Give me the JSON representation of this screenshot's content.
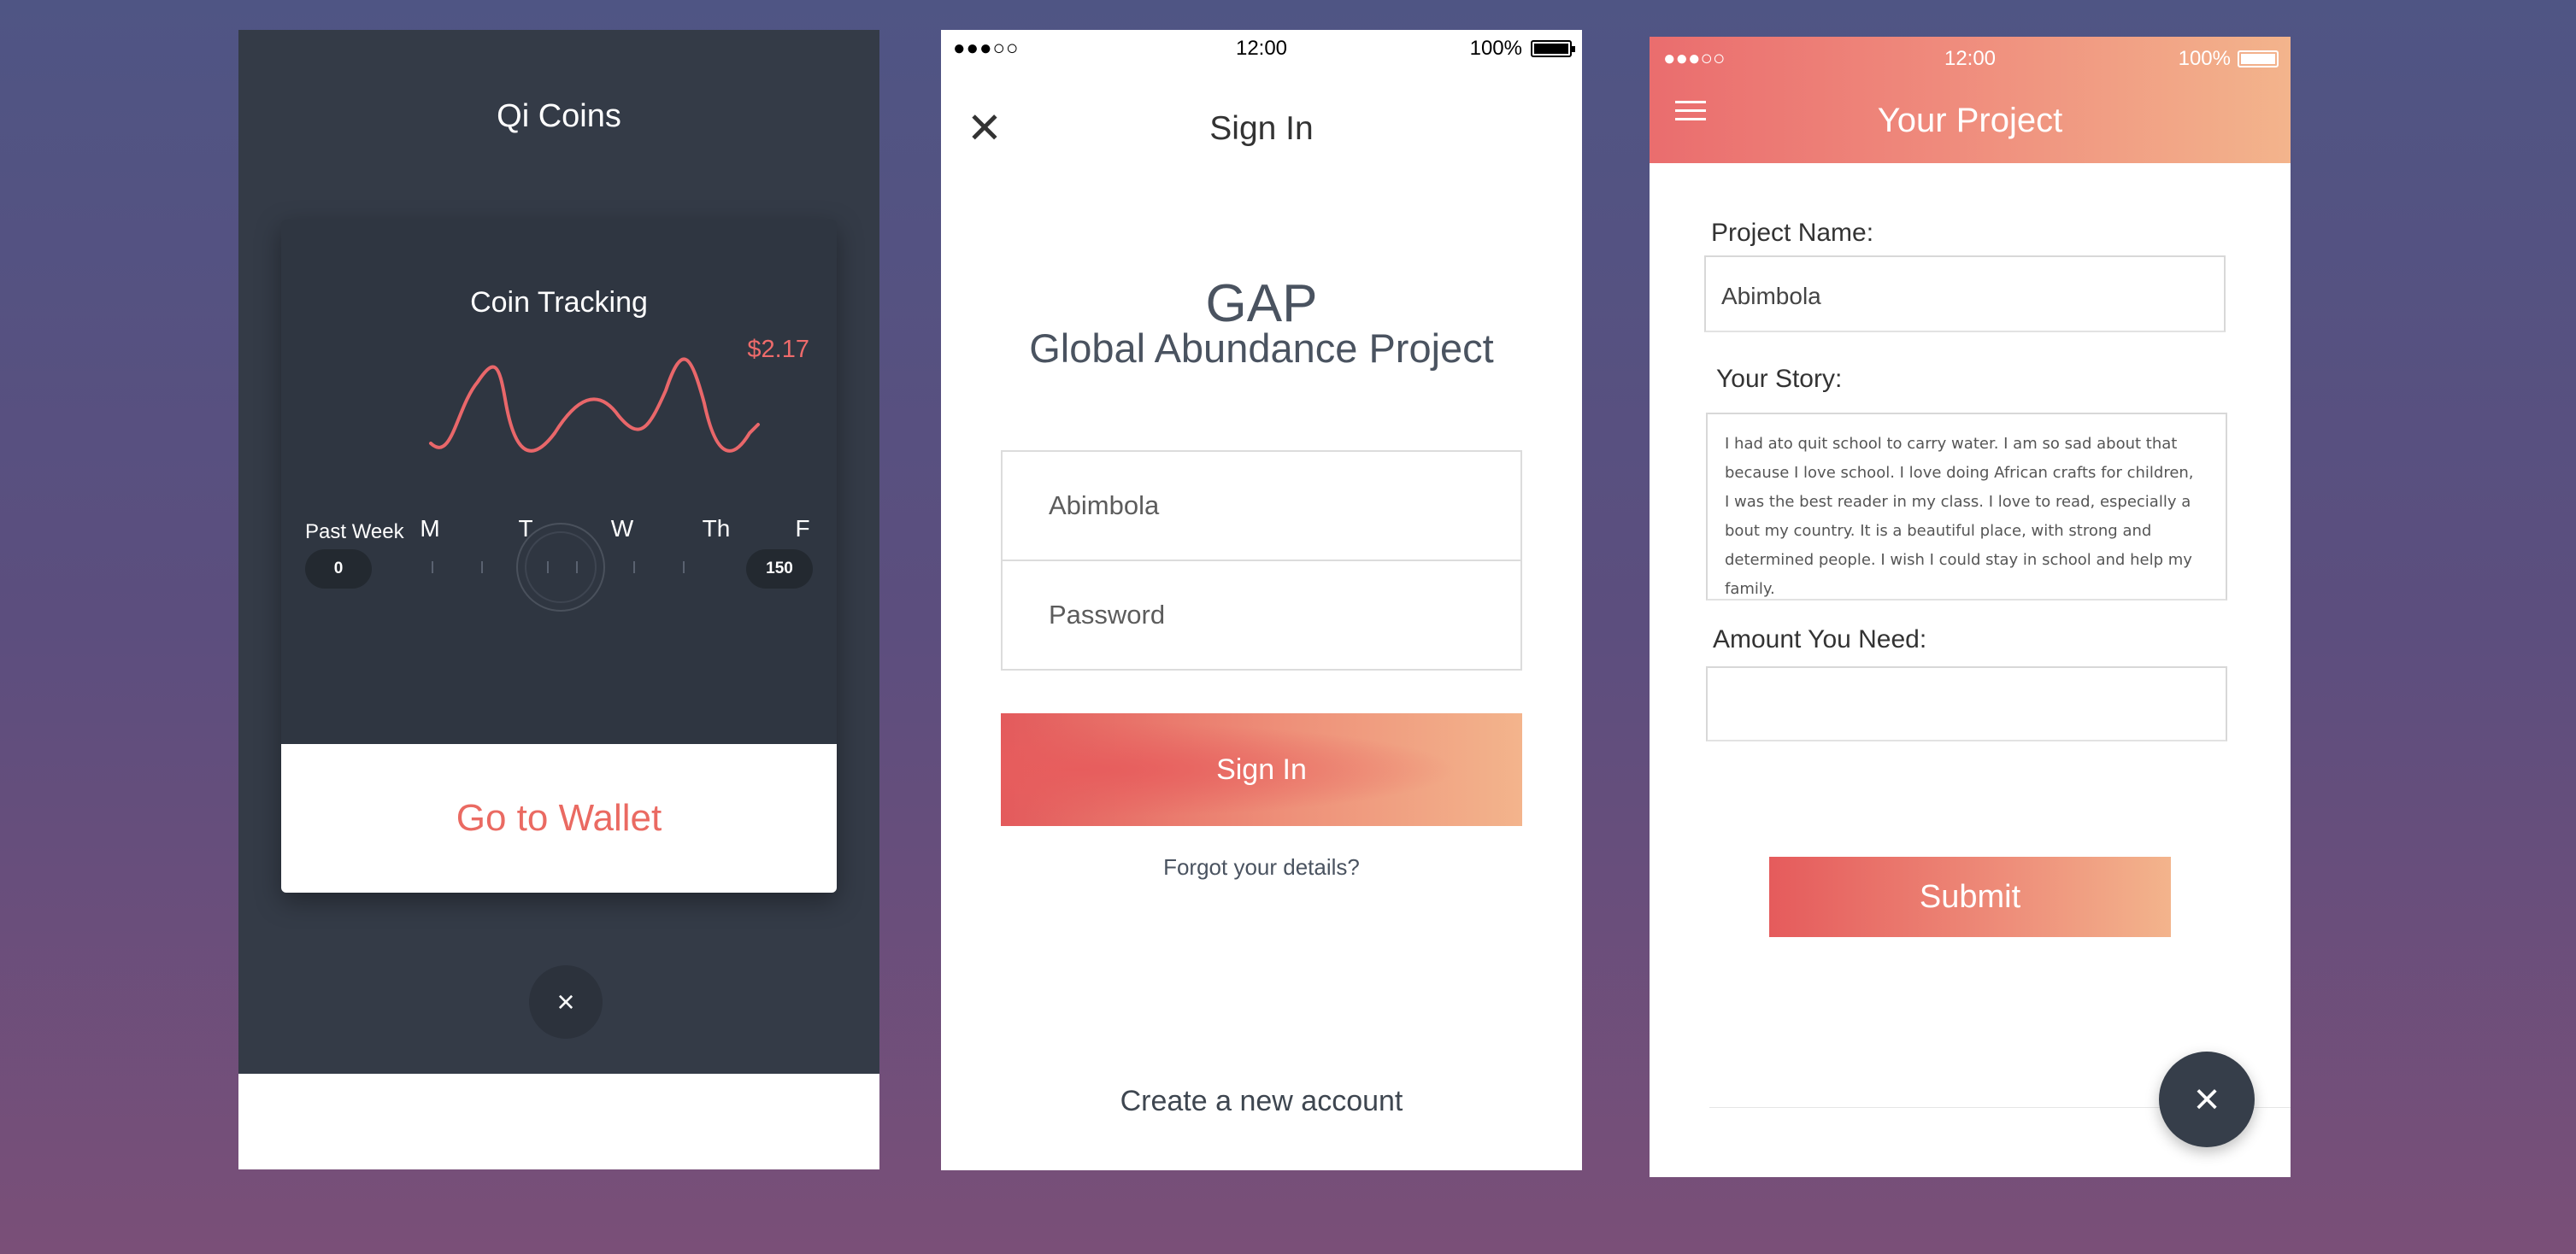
{
  "screen1": {
    "title": "Qi Coins",
    "card": {
      "title": "Coin Tracking",
      "price": "$2.17",
      "range_label": "Past Week",
      "days": [
        "M",
        "T",
        "W",
        "Th",
        "F"
      ],
      "min": "0",
      "max": "150"
    },
    "wallet_button": "Go to Wallet",
    "close_icon": "×",
    "colors": {
      "accent": "#ea6a62",
      "background": "#343b47"
    }
  },
  "screen2": {
    "status": {
      "signal": "●●●○○",
      "time": "12:00",
      "battery": "100%"
    },
    "close_icon": "✕",
    "title": "Sign In",
    "brand": "GAP",
    "brand_sub": "Global Abundance Project",
    "username": "Abimbola",
    "password_placeholder": "Password",
    "signin_button": "Sign In",
    "forgot": "Forgot your details?",
    "create": "Create a new account"
  },
  "screen3": {
    "status": {
      "signal": "●●●○○",
      "time": "12:00",
      "battery": "100%"
    },
    "title": "Your Project",
    "project_name_label": "Project Name:",
    "project_name_value": "Abimbola",
    "story_label": "Your Story:",
    "story_text": "I had ato quit school to carry water.  I am so sad about that\nbecause I love school. I love doing African crafts for children,\nI was the best reader in my class. I love to read, especially a\nbout my country.  It is a beautiful place, with strong and\ndetermined people.  I wish I could stay in school and help my family.",
    "amount_label": "Amount You Need:",
    "amount_value": "",
    "submit_button": "Submit",
    "fab_icon": "×",
    "colors": {
      "gradient_start": "#e55b5c",
      "gradient_end": "#f3b48c"
    }
  }
}
